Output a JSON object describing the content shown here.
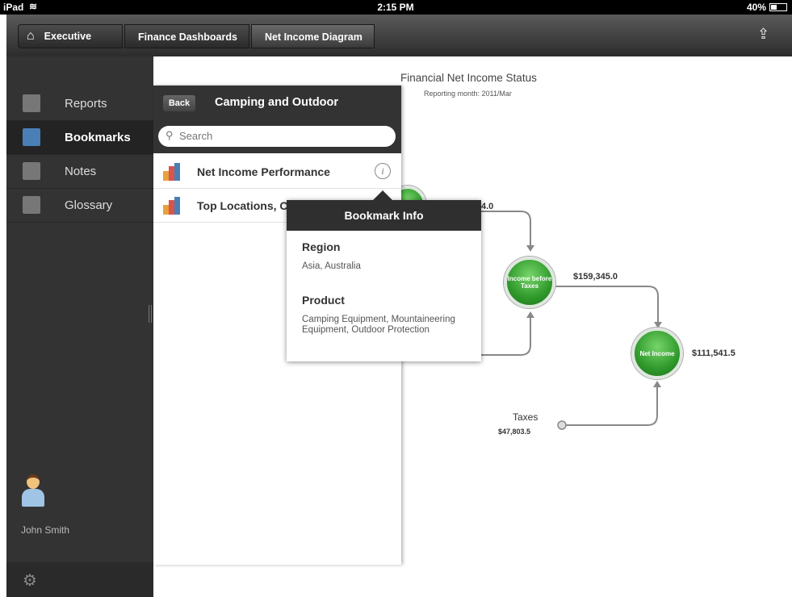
{
  "status_bar": {
    "device": "iPad",
    "time": "2:15 PM",
    "battery": "40%"
  },
  "breadcrumb": [
    "Executive",
    "Finance Dashboards",
    "Net Income Diagram"
  ],
  "sidebar": {
    "items": [
      {
        "label": "Reports",
        "icon": "reports-icon"
      },
      {
        "label": "Bookmarks",
        "icon": "bookmarks-icon",
        "selected": true
      },
      {
        "label": "Notes",
        "icon": "notes-icon"
      },
      {
        "label": "Glossary",
        "icon": "glossary-icon"
      }
    ],
    "user_name": "John Smith"
  },
  "panel": {
    "back_label": "Back",
    "title": "Camping and Outdoor",
    "search_placeholder": "Search",
    "bookmarks": [
      {
        "label": "Net Income Performance"
      },
      {
        "label": "Top Locations, C"
      }
    ]
  },
  "popover": {
    "title": "Bookmark Info",
    "region_label": "Region",
    "region_value": "Asia, Australia",
    "product_label": "Product",
    "product_value": "Camping Equipment, Mountaineering Equipment, Outdoor Protection"
  },
  "diagram": {
    "title": "Financial Net Income Status",
    "subtitle": "Reporting month: 2011/Mar",
    "partial_value": "4.0",
    "nodes": {
      "income_before_taxes": "Income before Taxes",
      "net_income": "Net Income"
    },
    "values": {
      "income_before_taxes": "$159,345.0",
      "net_income": "$111,541.5",
      "taxes_label": "Taxes",
      "taxes_value": "$47,803.5"
    },
    "colors": {
      "node_green": "#2f9a2b"
    }
  }
}
